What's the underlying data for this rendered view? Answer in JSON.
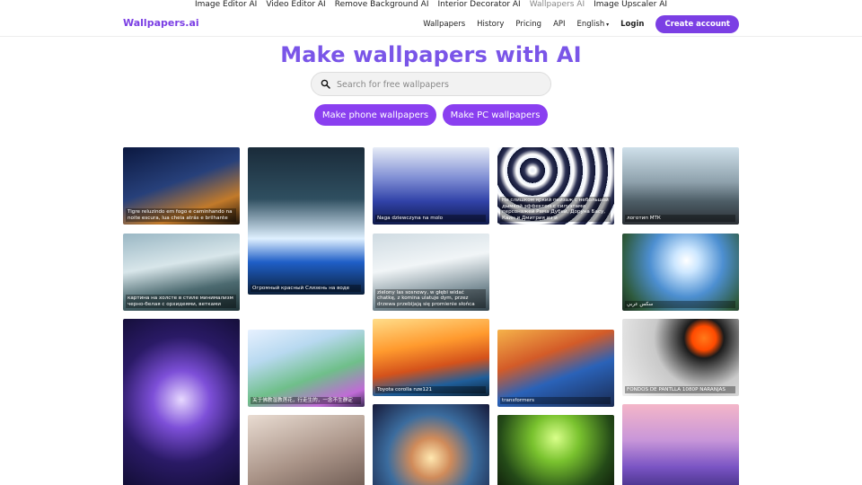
{
  "top_links": [
    "Image Editor AI",
    "Video Editor AI",
    "Remove Background AI",
    "Interior Decorator AI",
    "Wallpapers AI",
    "Image Upscaler AI"
  ],
  "top_active_index": 4,
  "nav": {
    "logo": "Wallpapers.ai",
    "wallpapers": "Wallpapers",
    "history": "History",
    "pricing": "Pricing",
    "api": "API",
    "language": "English",
    "login": "Login",
    "create_account": "Create account"
  },
  "hero": {
    "title": "Make wallpapers with AI",
    "search_placeholder": "Search for free wallpapers",
    "phone_button": "Make phone wallpapers",
    "pc_button": "Make PC wallpapers"
  },
  "gallery": [
    [
      {
        "caption": "Tigre reluzindo em fogo e caminhando na noite escura, lua cheia atrás e brilhante",
        "bg": "linear-gradient(160deg,#0b1840 0%,#27407a 45%,#c27a2a 75%,#1b1208 100%)"
      },
      {
        "caption": "картина на холсте в стиле минимализм черно-белая с орхидеями, ветками",
        "bg": "linear-gradient(170deg,#9ab7c4 0%,#d8e6ea 40%,#4c6a70 70%,#1f3337 100%)"
      },
      {
        "caption": "",
        "bg": "radial-gradient(circle at 50% 45%,#e7d8ff 0%,#7d4fd8 25%,#2a1a66 55%,#0c0a28 100%)"
      }
    ],
    [
      {
        "caption": "Огромный красный Слизень на воде",
        "bg": "linear-gradient(180deg,#1a2b3a 0%,#2f4f60 35%,#dff0ff 62%,#1f5fc7 78%,#0b1f3a 100%)"
      },
      {
        "caption": "关于佛教湿教莲花，行走生的，一念不生静定",
        "bg": "linear-gradient(160deg,#e7f1ff 0%,#b8d9f0 30%,#6fbf8a 60%,#c06bd6 85%,#3b2a55 100%)"
      },
      {
        "caption": "",
        "bg": "linear-gradient(160deg,#e9dcd2 0%,#a99387 50%,#5c4a43 100%)"
      }
    ],
    [
      {
        "caption": "Naga dziewczyna na molo",
        "bg": "linear-gradient(180deg,#e6ecf7 0%,#7f8ed4 40%,#3142a8 70%,#0f1a4a 100%)"
      },
      {
        "caption": "zielony las sosnowy, w głębi widać chatkę, z komina ulatuje dym, przez drzewa przebijają się promienie słońca",
        "bg": "linear-gradient(170deg,#cfdbe2 0%,#f1f5f7 40%,#7a8d96 75%,#33434b 100%)"
      },
      {
        "caption": "Toyota corolla nze121",
        "bg": "linear-gradient(170deg,#ffdd8a 0%,#ff9a2e 35%,#d4521b 60%,#1f5e9a 80%,#0c2236 100%)"
      },
      {
        "caption": "",
        "bg": "radial-gradient(circle at 50% 60%,#ffe8b0 0%,#d08b5a 25%,#3b6c9e 55%,#161a3a 100%)"
      }
    ],
    [
      {
        "caption": "Не слишком яркий пейзаж с небольшой дымкой эффектом с силуэтами персонажей Рама Дубей, Доруна Басу, Каин и Дмитрия из и",
        "bg": "repeating-radial-gradient(circle at 30% 30%,#e8eef8 0px,#ffffff 4px,#2a2f52 9px,#0f1433 14px)"
      },
      {
        "caption": "transformers",
        "bg": "linear-gradient(160deg,#f6b24a 0%,#d35b28 35%,#2a62b8 60%,#1a2b52 100%)"
      },
      {
        "caption": "",
        "bg": "radial-gradient(circle at 50% 30%,#d9ff8a 0%,#79c22e 30%,#244a18 70%,#0e1a09 100%)"
      }
    ],
    [
      {
        "caption": "логотип МТК",
        "bg": "linear-gradient(180deg,#cfe0ea 0%,#8ea1ac 45%,#4d5d66 70%,#2a2e33 100%)"
      },
      {
        "caption": "سكس عربي",
        "bg": "radial-gradient(circle at 55% 35%,#ffffff 0%,#cde7ff 15%,#4d8fd1 45%,#2e5a3c 80%,#1a2a20 100%)"
      },
      {
        "caption": "FONDOS DE PANTLLA 1080P NARANJAS",
        "bg": "radial-gradient(circle at 70% 25%,#ff7a1a 0%,#ff4a00 12%,#1b1b1b 20%,#c9c9c9 50%,#f0f0f0 100%)"
      },
      {
        "caption": "",
        "bg": "linear-gradient(180deg,#f4b6c8 0%,#c896d9 40%,#7a54c4 70%,#3b2a7a 100%)"
      }
    ]
  ]
}
